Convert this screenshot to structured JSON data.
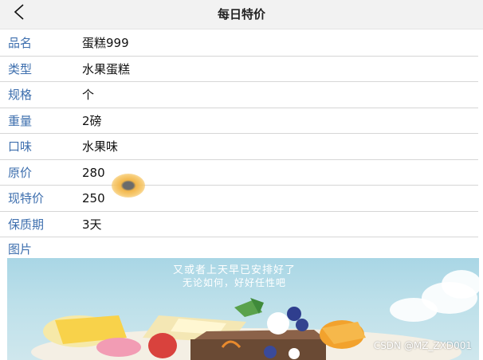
{
  "header": {
    "back_icon": "chevron-left-icon",
    "title": "每日特价"
  },
  "details": [
    {
      "label": "品名",
      "value": "蛋糕999"
    },
    {
      "label": "类型",
      "value": "水果蛋糕"
    },
    {
      "label": "规格",
      "value": "个"
    },
    {
      "label": "重量",
      "value": "2磅"
    },
    {
      "label": "口味",
      "value": "水果味"
    },
    {
      "label": "原价",
      "value": "280"
    },
    {
      "label": "现特价",
      "value": "250"
    },
    {
      "label": "保质期",
      "value": "3天"
    }
  ],
  "image_section": {
    "label": "图片",
    "banner_line1": "又或者上天早已安排好了",
    "banner_line2": "无论如何，好好任性吧"
  },
  "watermark": "CSDN @MZ_ZXD001",
  "colors": {
    "label": "#3e6fae",
    "header_bg": "#f2f2f2",
    "sky": "#a9d6e5"
  }
}
